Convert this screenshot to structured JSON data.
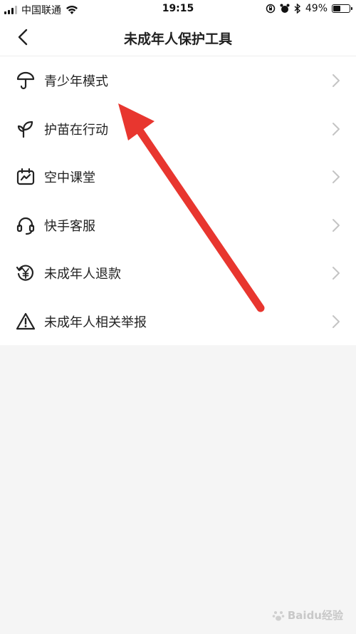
{
  "status_bar": {
    "carrier": "中国联通",
    "time": "19:15",
    "battery_percent": "49%",
    "battery_level": 0.49
  },
  "nav": {
    "title": "未成年人保护工具",
    "back_icon": "chevron-left-icon"
  },
  "menu": {
    "items": [
      {
        "label": "青少年模式",
        "icon": "umbrella-icon"
      },
      {
        "label": "护苗在行动",
        "icon": "sprout-icon"
      },
      {
        "label": "空中课堂",
        "icon": "classroom-icon"
      },
      {
        "label": "快手客服",
        "icon": "headset-icon"
      },
      {
        "label": "未成年人退款",
        "icon": "refund-icon"
      },
      {
        "label": "未成年人相关举报",
        "icon": "warning-icon"
      }
    ]
  },
  "annotation": {
    "color": "#e8362f"
  },
  "watermark": {
    "text": "Baidu经验"
  }
}
